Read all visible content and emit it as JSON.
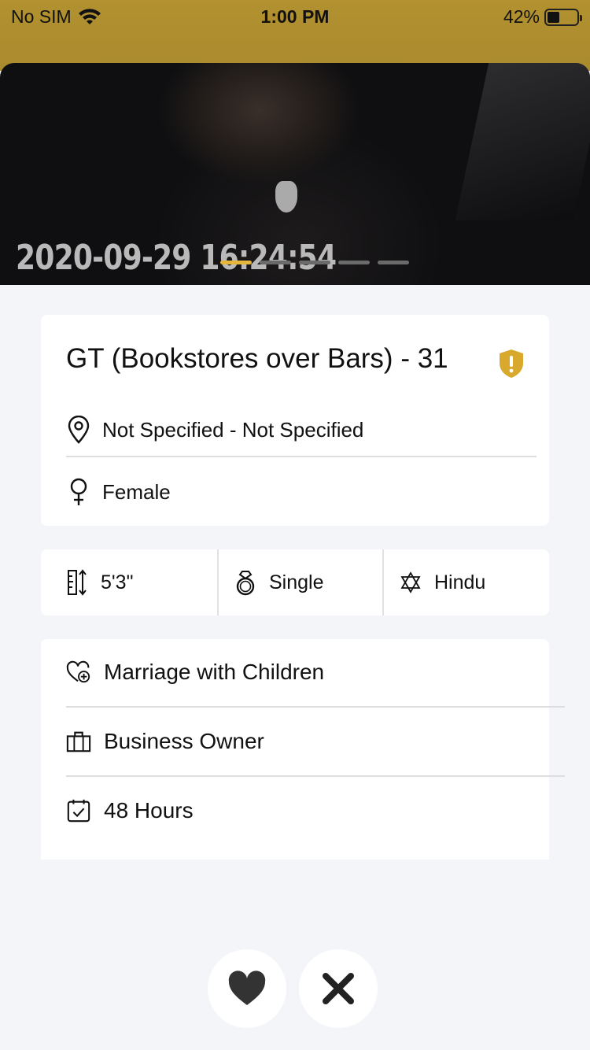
{
  "status_bar": {
    "carrier": "No SIM",
    "time": "1:00 PM",
    "battery": "42%",
    "battery_level": 0.42
  },
  "photo": {
    "timestamp_overlay": "2020-09-29 16:24:54",
    "page_count": 5,
    "active_page": 1
  },
  "profile": {
    "title": "GT (Bookstores over Bars) - 31",
    "location": "Not Specified - Not Specified",
    "gender": "Female"
  },
  "stats": {
    "height": "5'3\"",
    "status": "Single",
    "religion": "Hindu"
  },
  "details": {
    "intent": "Marriage with Children",
    "occupation": "Business Owner",
    "response_time": "48 Hours"
  },
  "colors": {
    "accent": "#e4b63a",
    "header": "#b2912f",
    "shield": "#d8a92c"
  },
  "icons": {
    "like": "heart-icon",
    "dislike": "close-icon"
  }
}
